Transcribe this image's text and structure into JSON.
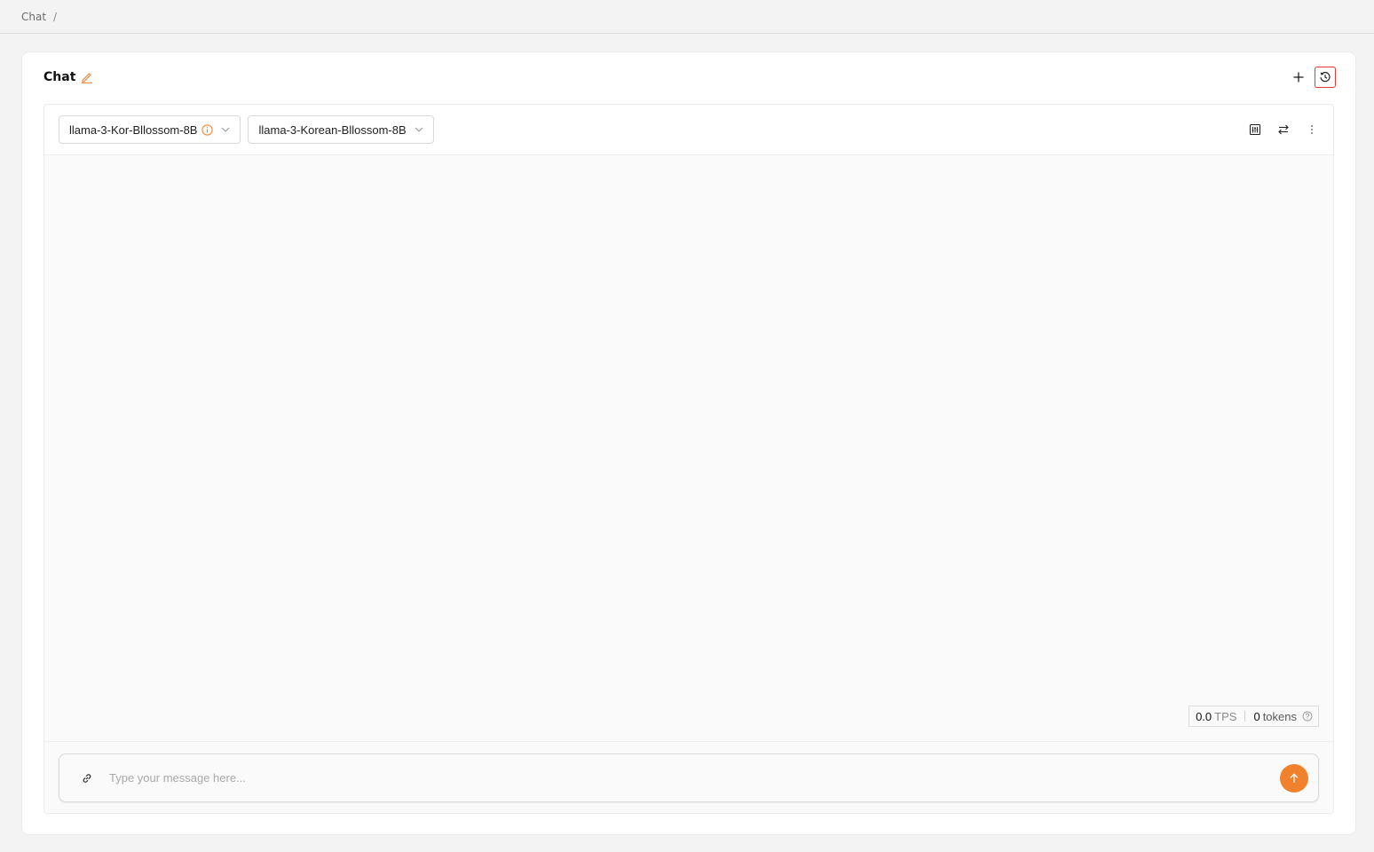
{
  "breadcrumb": {
    "item": "Chat",
    "separator": "/"
  },
  "card": {
    "title": "Chat"
  },
  "models": [
    {
      "label": "llama-3-Kor-Bllossom-8B",
      "has_info": true
    },
    {
      "label": "llama-3-Korean-Bllossom-8B",
      "has_info": false
    }
  ],
  "stats": {
    "tps_value": "0.0",
    "tps_unit": "TPS",
    "tokens_value": "0",
    "tokens_unit": "tokens"
  },
  "composer": {
    "placeholder": "Type your message here..."
  },
  "colors": {
    "accent": "#f0822d",
    "highlight": "#e53935"
  },
  "icons": {
    "header": [
      "edit-icon",
      "plus-icon",
      "history-icon"
    ],
    "toolbar": [
      "sliders-icon",
      "swap-icon",
      "more-vertical-icon"
    ],
    "composer": [
      "link-icon",
      "arrow-up-icon"
    ]
  }
}
